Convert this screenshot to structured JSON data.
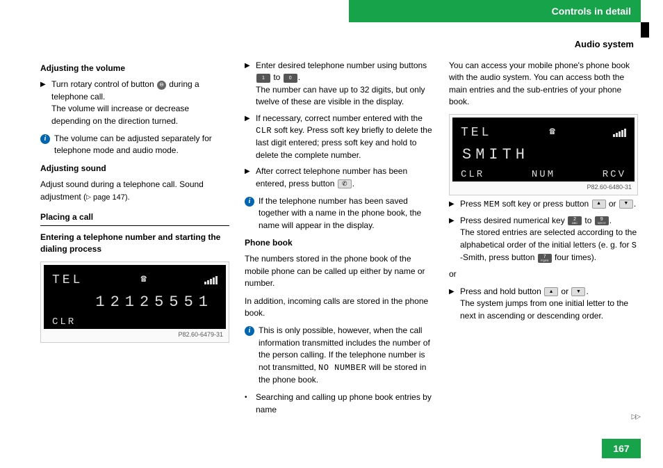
{
  "header": {
    "title": "Controls in detail",
    "sub": "Audio system"
  },
  "page": {
    "number": "167"
  },
  "col1": {
    "h1": "Adjusting the volume",
    "b1": "Turn rotary control of button ",
    "b1_tail": " during a telephone call.",
    "b1_line2": "The volume will increase or decrease depending on the direction turned.",
    "info1": "The volume can be adjusted separately for telephone mode and audio mode.",
    "h2": "Adjusting sound",
    "p2": "Adjust sound during a telephone call. Sound adjustment (",
    "p2_ref": " page 147).",
    "section": "Placing a call",
    "h3": "Entering a telephone number and starting the dialing process",
    "lcd": {
      "tel": "TEL",
      "num": "12125551",
      "clr": "CLR",
      "caption": "P82.60-6479-31"
    }
  },
  "col2": {
    "b1a": "Enter desired telephone number using buttons ",
    "b1b": " to ",
    "b1c": ".",
    "b1_line2": "The number can have up to 32 digits, but only twelve of these are visible in the display.",
    "b2": "If necessary, correct number entered with the ",
    "b2_clr": "CLR",
    "b2_tail": " soft key. Press soft key briefly to delete the last digit entered; press soft key and hold to delete the complete number.",
    "b3a": "After correct telephone number has been entered, press button ",
    "b3b": ".",
    "info1": "If the telephone number has been saved together with a name in the phone book, the name will appear in the display.",
    "h_pb": "Phone book",
    "pb_p1": "The numbers stored in the phone book of the mobile phone can be called up either by name or number.",
    "pb_p2": "In addition, incoming calls are stored in the phone book.",
    "info2a": "This is only possible, however, when the call information transmitted includes the number of the person calling. If the telephone number is not transmitted, ",
    "info2_no": "NO NUMBER",
    "info2b": " will be stored in the phone book.",
    "search": "Searching and calling up phone book entries by name"
  },
  "col3": {
    "intro": "You can access your mobile phone's phone book with the audio system. You can access both the main entries and the sub-entries of your phone book.",
    "lcd": {
      "tel": "TEL",
      "name": "SMITH",
      "clr": "CLR",
      "num": "NUM",
      "rcv": "RCV",
      "caption": "P82.60-6480-31"
    },
    "b1a": "Press ",
    "b1_mem": "MEM",
    "b1b": " soft key or press button ",
    "b1c": " or ",
    "b1d": ".",
    "b2a": "Press desired numerical key ",
    "b2b": " to ",
    "b2c": ".",
    "b2_line2a": "The stored entries are selected according to the alphabetical order of the initial letters (e. g. for ",
    "b2_s": "S",
    "b2_line2b": " -Smith, press button ",
    "b2_line2c": " four times).",
    "or": "or",
    "b3a": "Press and hold button ",
    "b3b": " or ",
    "b3c": ".",
    "b3_line2": "The system jumps from one initial letter to the next in ascending or descending order."
  },
  "keys": {
    "one": "1",
    "zero": "0",
    "two": "2",
    "two_sub": "ABC",
    "nine": "9",
    "nine_sub": "WXYZ",
    "seven": "7",
    "seven_sub": "PQRS"
  }
}
